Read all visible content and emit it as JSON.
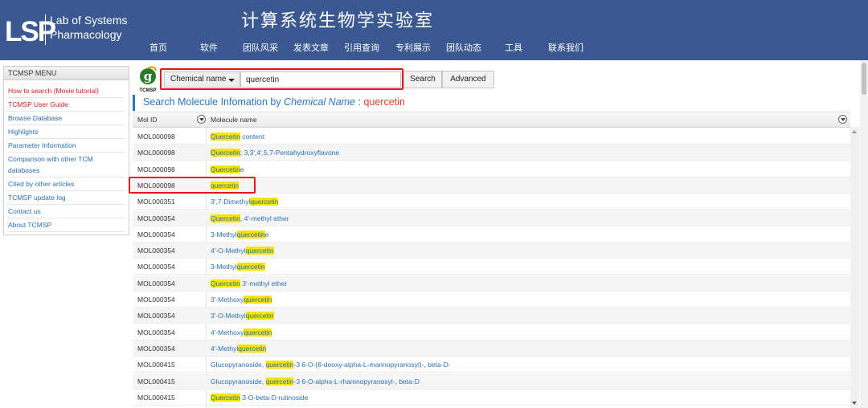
{
  "header": {
    "logo": "LSP",
    "logo_line1": "Lab of Systems",
    "logo_line2": "Pharmacology",
    "title": "计算系统生物学实验室",
    "nav": [
      "首页",
      "软件",
      "团队风采",
      "发表文章",
      "引用查询",
      "专利展示",
      "团队动态",
      "工具",
      "联系我们"
    ]
  },
  "sidebar": {
    "title": "TCMSP MENU",
    "items": [
      {
        "label": "How to search (Movie tutorial)",
        "style": "red"
      },
      {
        "label": "TCMSP User Guide",
        "style": "red"
      },
      {
        "label": "Browse Database",
        "style": "blue"
      },
      {
        "label": "Highlights",
        "style": "blue"
      },
      {
        "label": "Parameter Information",
        "style": "blue"
      },
      {
        "label": "Comparison with other TCM",
        "label2": "databases",
        "style": "blue"
      },
      {
        "label": "Cited by other articles",
        "style": "blue"
      },
      {
        "label": "TCMSP update log",
        "style": "blue"
      },
      {
        "label": "Contact us",
        "style": "blue"
      },
      {
        "label": "About TCMSP",
        "style": "blue"
      }
    ]
  },
  "search": {
    "logo_text": "TCMSP",
    "field": "Chemical name",
    "query": "quercetin",
    "search_label": "Search",
    "advanced_label": "Advanced"
  },
  "results": {
    "heading_prefix": "Search Molecule Infomation by ",
    "heading_field": "Chemical Name",
    "heading_sep": " : ",
    "heading_query": "quercetin",
    "columns": [
      "Mol ID",
      "Molecule name"
    ],
    "rows": [
      {
        "id": "MOL000098",
        "pre": "",
        "hl": "Quercetin",
        "post": " content"
      },
      {
        "id": "MOL000098",
        "pre": "",
        "hl": "Quercetin",
        "post": "; 3,3',4',5,7-Pentahydroxyflavone"
      },
      {
        "id": "MOL000098",
        "pre": "",
        "hl": "Quercetin",
        "post": "e"
      },
      {
        "id": "MOL000098",
        "pre": "",
        "hl": "quercetin",
        "post": ""
      },
      {
        "id": "MOL000351",
        "pre": "3',7-Dimethyl",
        "hl": "quercetin",
        "post": ""
      },
      {
        "id": "MOL000354",
        "pre": "",
        "hl": "Quercetin",
        "post": ", 4'-methyl ether"
      },
      {
        "id": "MOL000354",
        "pre": "3-Methyl",
        "hl": "quercetin",
        "post": "e"
      },
      {
        "id": "MOL000354",
        "pre": "4'-O-Methyl",
        "hl": "quercetin",
        "post": ""
      },
      {
        "id": "MOL000354",
        "pre": "3-Methyl",
        "hl": "quercetin",
        "post": ""
      },
      {
        "id": "MOL000354",
        "pre": "",
        "hl": "Quercetin",
        "post": " 3'-methyl ether"
      },
      {
        "id": "MOL000354",
        "pre": "3'-Methoxy",
        "hl": "quercetin",
        "post": ""
      },
      {
        "id": "MOL000354",
        "pre": "3'-O-Methyl",
        "hl": "quercetin",
        "post": ""
      },
      {
        "id": "MOL000354",
        "pre": "4'-Methoxy",
        "hl": "quercetin",
        "post": ""
      },
      {
        "id": "MOL000354",
        "pre": "4'-Methyl",
        "hl": "quercetin",
        "post": ""
      },
      {
        "id": "MOL000415",
        "pre": "Glucopyranoside, ",
        "hl": "quercetin",
        "post": "-3 6-O-(6-deoxy-alpha-L-mannopyranosyl)-, beta-D-"
      },
      {
        "id": "MOL000415",
        "pre": "Glucopyranoside, ",
        "hl": "quercetin",
        "post": "-3 6-O-alpha-L-rhamnopyranosyl-, beta-D"
      },
      {
        "id": "MOL000415",
        "pre": "",
        "hl": "Quercetin",
        "post": " 3-O-beta-D-rutinoside"
      }
    ]
  },
  "colors": {
    "header_bg": "#3c5890",
    "link": "#2a6fb5",
    "highlight": "#f7e500",
    "annotation_box": "#e11111"
  }
}
